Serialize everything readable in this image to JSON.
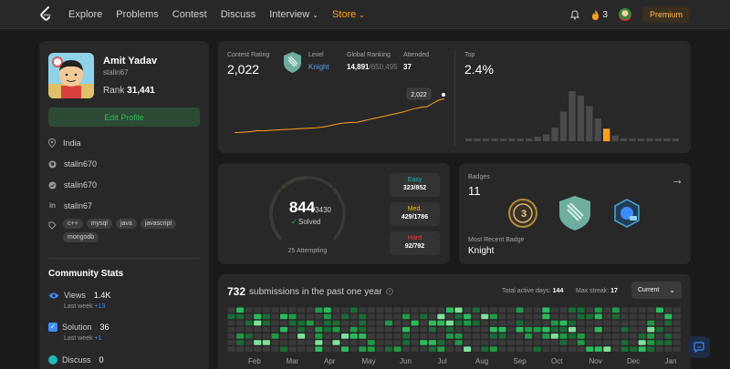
{
  "nav": {
    "links": [
      {
        "label": "Explore",
        "dropdown": false
      },
      {
        "label": "Problems",
        "dropdown": false
      },
      {
        "label": "Contest",
        "dropdown": false
      },
      {
        "label": "Discuss",
        "dropdown": false
      },
      {
        "label": "Interview",
        "dropdown": true
      },
      {
        "label": "Store",
        "dropdown": true
      }
    ],
    "streak_count": "3",
    "premium_label": "Premium",
    "accent_color": "#ffa116"
  },
  "profile": {
    "name": "Amit Yadav",
    "username": "stalin67",
    "rank_label": "Rank",
    "rank_value": "31,441",
    "edit_label": "Edit Profile",
    "location": "India",
    "github": "stalin670",
    "twitter": "stalin670",
    "linkedin": "stalin67",
    "skills": [
      "c++",
      "mysql",
      "java",
      "javascript",
      "mongodb"
    ]
  },
  "community": {
    "title": "Community Stats",
    "views_label": "Views",
    "views_value": "1.4K",
    "views_lastweek_label": "Last week",
    "views_lastweek_value": "+13",
    "solution_label": "Solution",
    "solution_value": "36",
    "solution_lastweek_label": "Last week",
    "solution_lastweek_value": "+1",
    "discuss_label": "Discuss",
    "discuss_value": "0"
  },
  "contest": {
    "rating_label": "Contest Rating",
    "rating_value": "2,022",
    "level_label": "Level",
    "level_value": "Knight",
    "global_label": "Global Ranking",
    "global_value": "14,891",
    "global_total": "/650,495",
    "attended_label": "Attended",
    "attended_value": "37",
    "top_label": "Top",
    "top_value": "2.4%",
    "tooltip": "2,022"
  },
  "rating_chart": {
    "points": [
      1500,
      1505,
      1510,
      1520,
      1530,
      1528,
      1535,
      1540,
      1545,
      1550,
      1555,
      1560,
      1565,
      1570,
      1575,
      1585,
      1600,
      1620,
      1640,
      1650,
      1655,
      1660,
      1680,
      1700,
      1720,
      1740,
      1760,
      1780,
      1800,
      1820,
      1850,
      1870,
      1890,
      1900,
      1950,
      2000,
      2022
    ]
  },
  "top_histogram": {
    "values": [
      3,
      3,
      3,
      3,
      3,
      3,
      4,
      5,
      8,
      12,
      24,
      52,
      88,
      80,
      62,
      40,
      22,
      10,
      5,
      4,
      3,
      3,
      3,
      3,
      3
    ],
    "highlight_index": 16
  },
  "solved": {
    "value": "844",
    "total": "/3430",
    "label": "Solved",
    "attempting": "25 Attempting",
    "easy_label": "Easy",
    "easy_value": "323/852",
    "easy_fraction": 0.379,
    "medium_label": "Med.",
    "medium_value": "429/1786",
    "medium_fraction": 0.24,
    "hard_label": "Hard",
    "hard_value": "92/792",
    "hard_fraction": 0.116,
    "easy_color": "#1cbaba",
    "medium_color": "#ffb700",
    "hard_color": "#f63737"
  },
  "badges": {
    "label": "Badges",
    "count": "11",
    "recent_label": "Most Recent Badge",
    "recent_value": "Knight"
  },
  "submissions": {
    "count": "732",
    "text": "submissions in the past one year",
    "active_label": "Total active days:",
    "active_value": "144",
    "streak_label": "Max streak:",
    "streak_value": "17",
    "dropdown_value": "Current",
    "months": [
      "Feb",
      "Mar",
      "Apr",
      "May",
      "Jun",
      "Jul",
      "Aug",
      "Sep",
      "Oct",
      "Nov",
      "Dec",
      "Jan"
    ]
  }
}
